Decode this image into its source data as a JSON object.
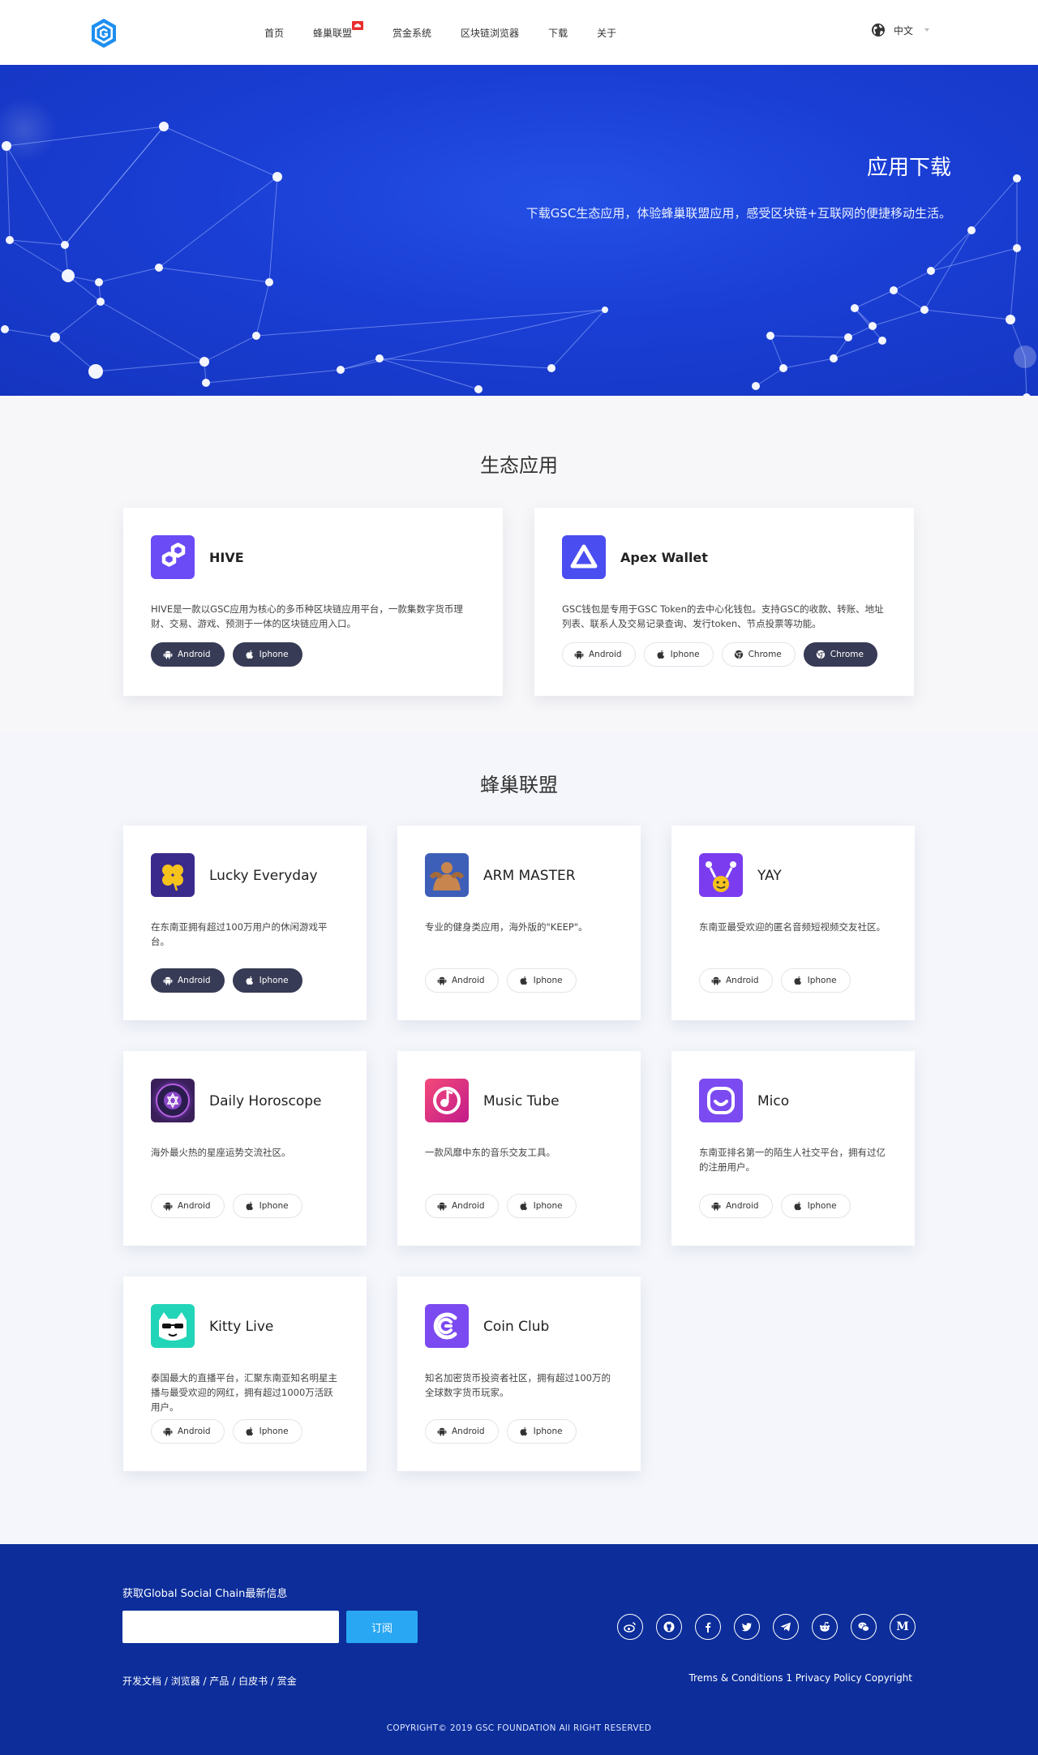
{
  "nav": {
    "items": [
      "首页",
      "蜂巢联盟",
      "赏金系统",
      "区块链浏览器",
      "下载",
      "关于"
    ],
    "language": "中文"
  },
  "hero": {
    "title": "应用下载",
    "subtitle": "下载GSC生态应用，体验蜂巢联盟应用，感受区块链+互联网的便捷移动生活。"
  },
  "eco": {
    "title": "生态应用",
    "apps": [
      {
        "name": "HIVE",
        "desc": "HIVE是一款以GSC应用为核心的多币种区块链应用平台，一款集数字货币理财、交易、游戏、预测于一体的区块链应用入口。",
        "buttons": [
          {
            "label": "Android",
            "icon": "android-icon",
            "style": "dark"
          },
          {
            "label": "Iphone",
            "icon": "apple-icon",
            "style": "dark"
          }
        ]
      },
      {
        "name": "Apex Wallet",
        "desc": "GSC钱包是专用于GSC Token的去中心化钱包。支持GSC的收款、转账、地址列表、联系人及交易记录查询、发行token、节点投票等功能。",
        "buttons": [
          {
            "label": "Android",
            "icon": "android-icon",
            "style": "light"
          },
          {
            "label": "Iphone",
            "icon": "apple-icon",
            "style": "light"
          },
          {
            "label": "Chrome",
            "icon": "chrome-icon",
            "style": "light"
          },
          {
            "label": "Chrome",
            "icon": "chrome-icon",
            "style": "dark"
          }
        ]
      }
    ]
  },
  "league": {
    "title": "蜂巢联盟",
    "apps": [
      {
        "name": "Lucky Everyday",
        "desc": "在东南亚拥有超过100万用户的休闲游戏平台。",
        "dark": true
      },
      {
        "name": "ARM MASTER",
        "desc": "专业的健身类应用，海外版的\"KEEP\"。",
        "dark": false
      },
      {
        "name": "YAY",
        "desc": "东南亚最受欢迎的匿名音频短视频交友社区。",
        "dark": false
      },
      {
        "name": "Daily Horoscope",
        "desc": "海外最火热的星座运势交流社区。",
        "dark": false
      },
      {
        "name": "Music Tube",
        "desc": "一款风靡中东的音乐交友工具。",
        "dark": false
      },
      {
        "name": "Mico",
        "desc": "东南亚排名第一的陌生人社交平台，拥有过亿的注册用户。",
        "dark": false
      },
      {
        "name": "Kitty Live",
        "desc": "泰国最大的直播平台，汇聚东南亚知名明星主播与最受欢迎的网红，拥有超过1000万活跃用户。",
        "dark": false
      },
      {
        "name": "Coin Club",
        "desc": "知名加密货币投资者社区，拥有超过100万的全球数字货币玩家。",
        "dark": false
      }
    ],
    "android_label": "Android",
    "iphone_label": "Iphone"
  },
  "footer": {
    "subscribe_title": "获取Global Social Chain最新信息",
    "email_placeholder": "",
    "subscribe_button": "订阅",
    "links": [
      "开发文档",
      "浏览器",
      "产品",
      "白皮书",
      "赏金"
    ],
    "terms": "Trems & Conditions 1 Privacy Policy Copyright",
    "copyright": "COPYRIGHT© 2019 GSC FOUNDATION All RIGHT RESERVED",
    "socials": [
      "weibo-icon",
      "github-icon",
      "facebook-icon",
      "twitter-icon",
      "telegram-icon",
      "reddit-icon",
      "wechat-icon",
      "medium-icon"
    ]
  },
  "colors": {
    "brand_blue": "#1a3ed4",
    "footer_blue": "#0c2d9a",
    "dark_button": "#373b55",
    "subscribe": "#29a7f2"
  }
}
